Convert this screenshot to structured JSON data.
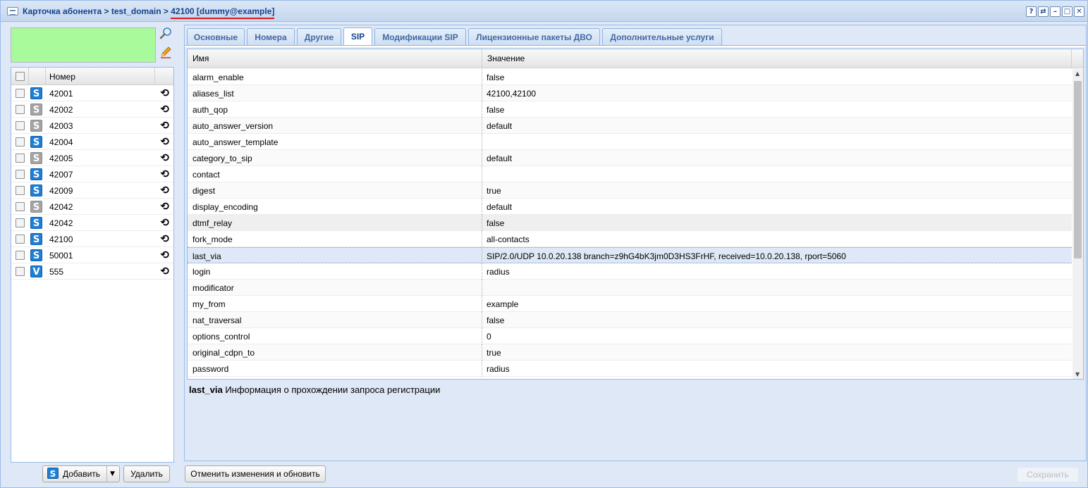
{
  "window": {
    "breadcrumb_prefix": "Карточка абонента > test_domain > ",
    "breadcrumb_current": "42100 [dummy@example]",
    "tools": [
      "?",
      "⇄",
      "–",
      "□",
      "✕"
    ]
  },
  "left": {
    "search_icon": "search-icon",
    "edit_icon": "pencil-icon",
    "grid_header_number": "Номер",
    "rows": [
      {
        "badge": "S",
        "type": "blue",
        "number": "42001"
      },
      {
        "badge": "S",
        "type": "gray",
        "number": "42002"
      },
      {
        "badge": "S",
        "type": "gray",
        "number": "42003"
      },
      {
        "badge": "S",
        "type": "blue",
        "number": "42004"
      },
      {
        "badge": "S",
        "type": "gray",
        "number": "42005"
      },
      {
        "badge": "S",
        "type": "blue",
        "number": "42007"
      },
      {
        "badge": "S",
        "type": "blue",
        "number": "42009"
      },
      {
        "badge": "S",
        "type": "gray",
        "number": "42042"
      },
      {
        "badge": "S",
        "type": "blue",
        "number": "42042"
      },
      {
        "badge": "S",
        "type": "blue",
        "number": "42100"
      },
      {
        "badge": "S",
        "type": "blue",
        "number": "50001"
      },
      {
        "badge": "V",
        "type": "blue",
        "number": "555"
      }
    ],
    "add_label": "Добавить",
    "add_icon": "S",
    "delete_label": "Удалить"
  },
  "tabs": [
    {
      "label": "Основные"
    },
    {
      "label": "Номера"
    },
    {
      "label": "Другие"
    },
    {
      "label": "SIP"
    },
    {
      "label": "Модификации SIP"
    },
    {
      "label": "Лицензионные пакеты ДВО"
    },
    {
      "label": "Дополнительные услуги"
    }
  ],
  "active_tab": "SIP",
  "grid": {
    "col_name": "Имя",
    "col_value": "Значение",
    "rows": [
      {
        "name": "alarm_enable",
        "value": "false"
      },
      {
        "name": "aliases_list",
        "value": "42100,42100"
      },
      {
        "name": "auth_qop",
        "value": "false"
      },
      {
        "name": "auto_answer_version",
        "value": "default"
      },
      {
        "name": "auto_answer_template",
        "value": ""
      },
      {
        "name": "category_to_sip",
        "value": "default"
      },
      {
        "name": "contact",
        "value": ""
      },
      {
        "name": "digest",
        "value": "true"
      },
      {
        "name": "display_encoding",
        "value": "default"
      },
      {
        "name": "dtmf_relay",
        "value": "false"
      },
      {
        "name": "fork_mode",
        "value": "all-contacts"
      },
      {
        "name": "last_via",
        "value": "SIP/2.0/UDP 10.0.20.138 branch=z9hG4bK3jm0D3HS3FrHF, received=10.0.20.138, rport=5060"
      },
      {
        "name": "login",
        "value": "radius"
      },
      {
        "name": "modificator",
        "value": ""
      },
      {
        "name": "my_from",
        "value": "example"
      },
      {
        "name": "nat_traversal",
        "value": "false"
      },
      {
        "name": "options_control",
        "value": "0"
      },
      {
        "name": "original_cdpn_to",
        "value": "true"
      },
      {
        "name": "password",
        "value": "radius"
      }
    ]
  },
  "description": {
    "key": "last_via",
    "text": " Информация о прохождении запроса регистрации"
  },
  "buttons": {
    "cancel_refresh": "Отменить изменения и обновить",
    "save": "Сохранить"
  }
}
